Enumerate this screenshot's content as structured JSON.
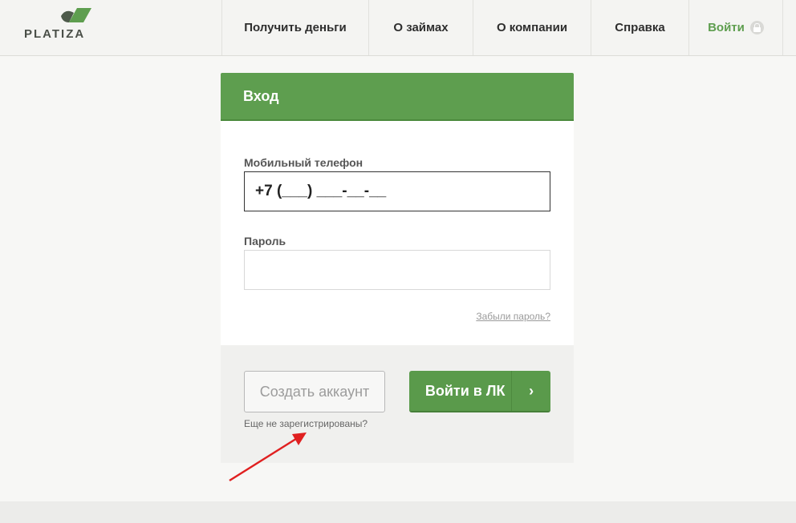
{
  "header": {
    "logo_text": "PLATIZA",
    "nav": [
      {
        "label": "Получить деньги"
      },
      {
        "label": "О займах"
      },
      {
        "label": "О компании"
      },
      {
        "label": "Справка"
      },
      {
        "label": "Войти"
      }
    ]
  },
  "login": {
    "title": "Вход",
    "phone_label": "Мобильный телефон",
    "phone_value": "+7 (___) ___-__-__",
    "password_label": "Пароль",
    "password_value": "",
    "forgot_link": "Забыли пароль?",
    "create_account_label": "Создать аккаунт",
    "not_registered_text": "Еще не зарегистрированы?",
    "login_button_label": "Войти в ЛК",
    "login_button_arrow": "›"
  },
  "colors": {
    "brand_green": "#5e9e4f",
    "annotation_red": "#e02020"
  }
}
